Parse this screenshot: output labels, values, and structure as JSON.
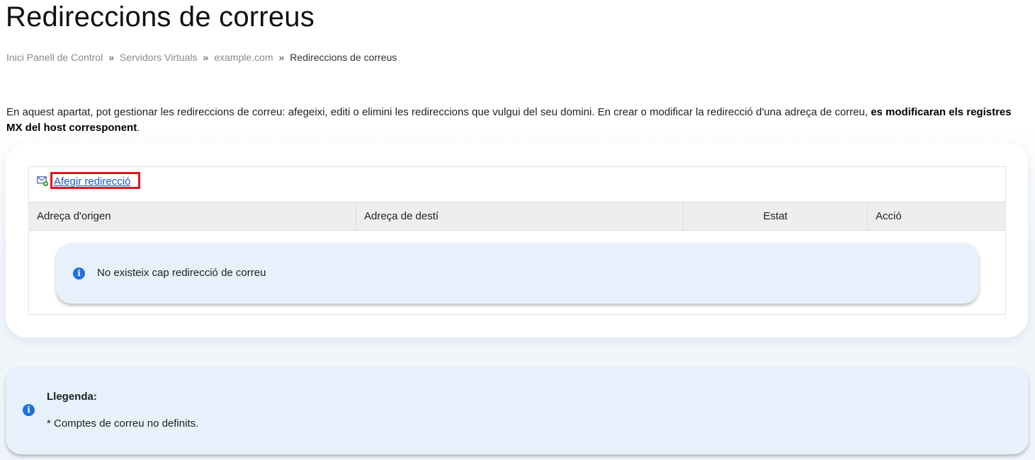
{
  "page": {
    "title": "Redireccions de correus"
  },
  "breadcrumb": {
    "items": [
      "Inici Panell de Control",
      "Servidors Virtuals",
      "example.com"
    ],
    "separator": "»",
    "current": "Redireccions de correus"
  },
  "intro": {
    "text": "En aquest apartat, pot gestionar les redireccions de correu: afegeixi, editi o elimini les redireccions que vulgui del seu domini. En crear o modificar la redirecció d'una adreça de correu, ",
    "bold": "es modificaran els registres MX del host corresponent",
    "end": "."
  },
  "toolbar": {
    "add_label": "Afegir redirecció",
    "add_icon": "mail-add-icon"
  },
  "table": {
    "columns": [
      "Adreça d'origen",
      "Adreça de destí",
      "Estat",
      "Acció"
    ],
    "empty_message": "No existeix cap redirecció de correu"
  },
  "legend": {
    "title": "Llegenda:",
    "items": [
      "* Comptes de correu no definits."
    ]
  },
  "colors": {
    "link": "#1a56c9",
    "highlight_border": "#e0141e",
    "info_blue": "#1f6fe0",
    "alert_bg": "#e7f1fc",
    "header_bg": "#eeeeee"
  }
}
